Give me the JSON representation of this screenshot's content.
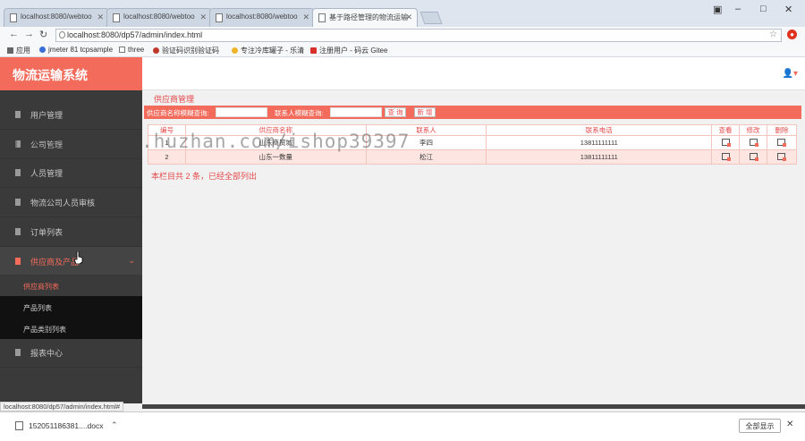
{
  "browser": {
    "tabs": [
      {
        "title": "localhost:8080/webtoo"
      },
      {
        "title": "localhost:8080/webtoo"
      },
      {
        "title": "localhost:8080/webtoo"
      },
      {
        "title": "基于路径管理的物流运输"
      }
    ],
    "url": "localhost:8080/dp57/admin/index.html",
    "bookmarks": [
      "应用",
      "jmeter 81 tcpsample",
      "three",
      "验证码识别验证码",
      "专注冷库罐子 - 乐清",
      "注册用户 - 码云 Gitee"
    ],
    "status_url": "localhost:8080/dp57/admin/index.html#"
  },
  "app": {
    "brand": "物流运输系统",
    "menu": [
      {
        "label": "用户管理"
      },
      {
        "label": "公司管理"
      },
      {
        "label": "人员管理"
      },
      {
        "label": "物流公司人员审核"
      },
      {
        "label": "订单列表"
      },
      {
        "label": "供应商及产品"
      },
      {
        "label": "报表中心"
      }
    ],
    "submenu": [
      {
        "label": "供应商列表"
      },
      {
        "label": "产品列表"
      },
      {
        "label": "产品类别列表"
      }
    ],
    "section_title": "供应商管理",
    "search": {
      "name_label": "供应商名称模糊查询:",
      "contact_label": "联系人模糊查询:",
      "query_button": "查 询",
      "add_button": "新 增"
    },
    "table": {
      "headers": [
        "编号",
        "供应商名称",
        "联系人",
        "联系电话",
        "查看",
        "修改",
        "删除"
      ],
      "rows": [
        {
          "id": "1",
          "name": "山东商贸城",
          "contact": "李四",
          "phone": "13811111111"
        },
        {
          "id": "2",
          "name": "山东一数量",
          "contact": "松江",
          "phone": "13811111111"
        }
      ]
    },
    "footer_note": "本栏目共 2 条，已经全部列出"
  },
  "watermark": "https://www.huzhan.com/ishop39397",
  "downloads": {
    "file": "152051186381....docx",
    "show_all": "全部显示"
  },
  "colors": {
    "accent": "#f26b5b",
    "sidebar": "#3a3a3a"
  }
}
